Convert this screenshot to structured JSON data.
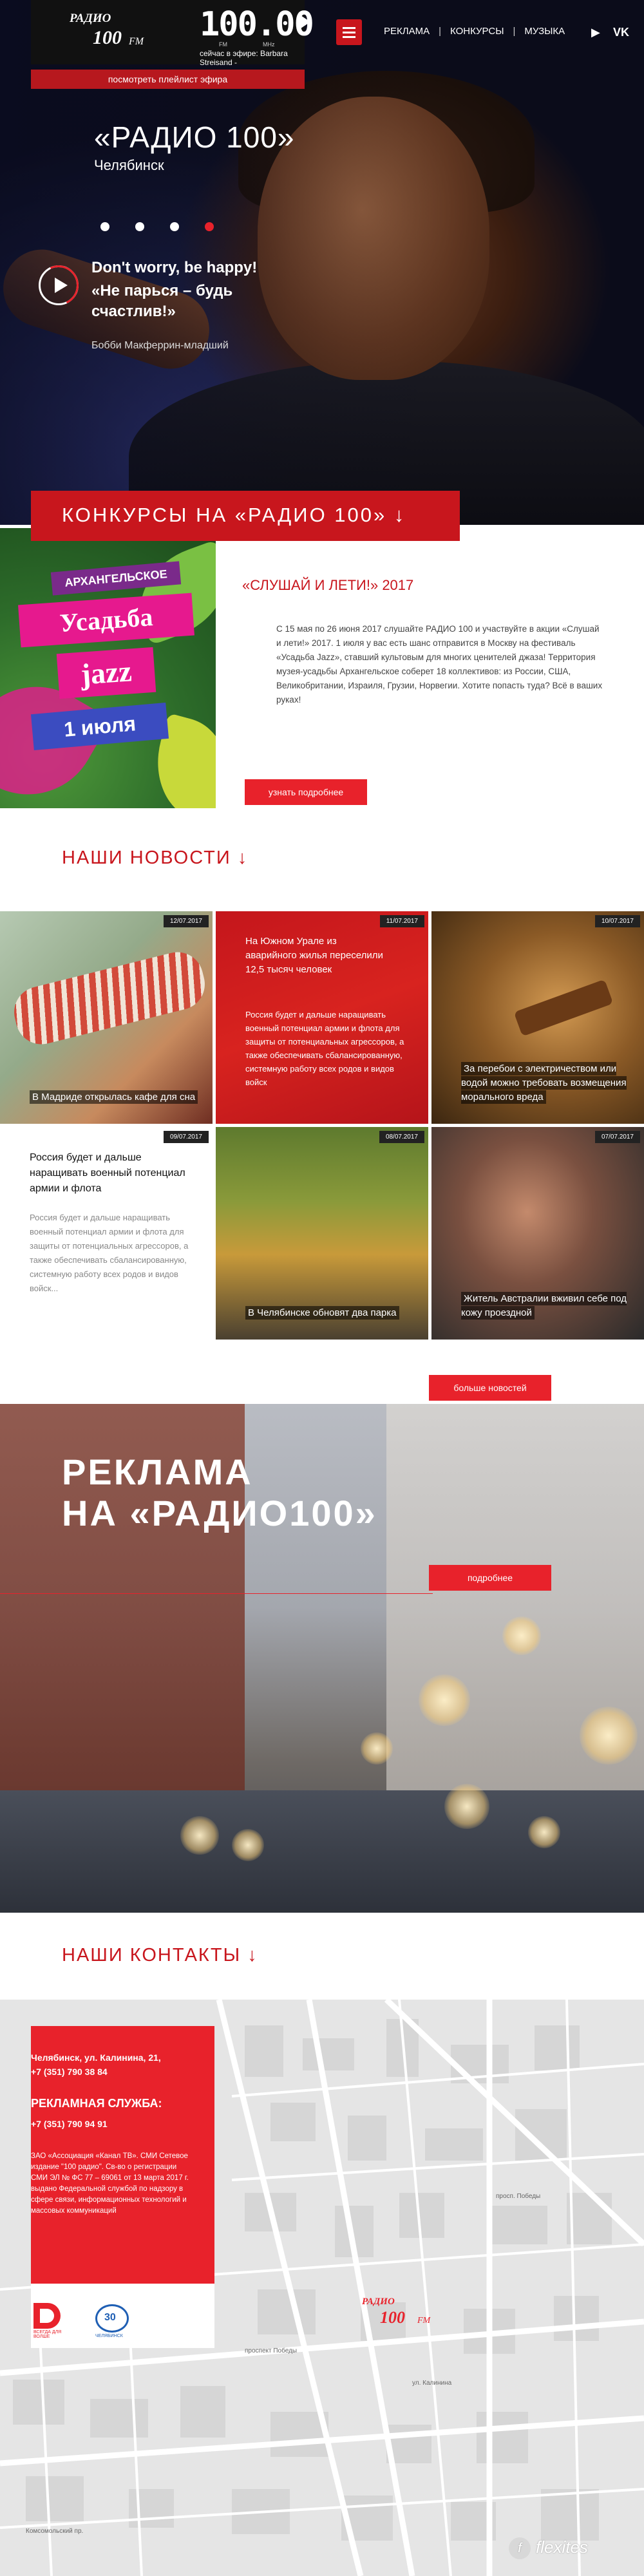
{
  "header": {
    "logo_line1": "РАДИО",
    "logo_line2": "100",
    "logo_line3": "FM",
    "frequency": "100.00",
    "freq_fm": "FM",
    "freq_mhz": "MHz",
    "now_on_air": "сейчас в эфире: Barbara Streisand -",
    "playlist_button": "посмотреть плейлист эфира",
    "nav": [
      "РЕКЛАМА",
      "КОНКУРСЫ",
      "МУЗЫКА"
    ],
    "social_youtube": "▶",
    "social_vk": "VK",
    "brand_red": "#e8222b"
  },
  "hero": {
    "title": "«РАДИО 100»",
    "city": "Челябинск",
    "song_en": "Don't worry, be happy!",
    "song_ru": "«Не парься – будь счастлив!»",
    "artist": "Бобби Макферрин-младший",
    "slides": 4,
    "active_slide": 4
  },
  "contests": {
    "section_title": "КОНКУРСЫ НА «РАДИО 100»",
    "arrow": "↓",
    "card_ribbon1": "АРХАНГЕЛЬСКОЕ",
    "card_ribbon2": "Усадьба",
    "card_ribbon3": "jazz",
    "card_ribbon4": "1 июля",
    "heading": "«СЛУШАЙ И ЛЕТИ!» 2017",
    "text": "С 15 мая по 26 июня 2017 слушайте РАДИО 100 и участвуйте в акции «Слушай и лети!» 2017. 1 июля у вас есть шанс отправится в Москву на фестиваль «Усадьба Jazz», ставший культовым для многих ценителей джаза! Территория музея-усадьбы Архангельское соберет 18 коллективов: из России, США, Великобритании, Израиля, Грузии, Норвегии. Хотите попасть туда? Всё в ваших руках!",
    "button": "узнать подробнее"
  },
  "news": {
    "section_title": "НАШИ НОВОСТИ",
    "arrow": "↓",
    "items": [
      {
        "date": "12/07.2017",
        "title": "В Мадриде открылась кафе для сна"
      },
      {
        "date": "11/07.2017",
        "title": "На Южном Урале из аварийного жилья переселили 12,5 тысяч человек",
        "excerpt": "Россия будет и дальше наращивать военный потенциал армии и флота для защиты от потенциальных агрессоров, а также обеспечивать сбалансированную, системную работу всех родов и видов войск"
      },
      {
        "date": "10/07.2017",
        "title": "За перебои с электричеством или водой можно требовать возмещения морального вреда"
      },
      {
        "date": "09/07.2017",
        "title": "Россия будет и дальше наращивать военный потенциал армии и флота",
        "excerpt": "Россия будет и дальше наращивать военный потенциал армии и флота для защиты от потенциальных агрессоров, а также обеспечивать сбалансированную, системную работу всех родов и видов войск..."
      },
      {
        "date": "08/07.2017",
        "title": "В Челябинске обновят два парка"
      },
      {
        "date": "07/07.2017",
        "title": "Житель Австралии вживил себе под кожу проездной"
      }
    ],
    "more_button": "больше новостей"
  },
  "ads": {
    "title_line1": "РЕКЛАМА",
    "title_line2": "НА «РАДИО100»",
    "button": "подробнее"
  },
  "contacts": {
    "section_title": "НАШИ КОНТАКТЫ",
    "arrow": "↓",
    "address": "Челябинск, ул. Калинина, 21,",
    "phone1": "+7 (351) 790 38 84",
    "ads_service_label": "РЕКЛАМНАЯ СЛУЖБА:",
    "phone2": "+7 (351) 790 94 91",
    "legal": "ЗАО «Ассоциация «Канал ТВ». СМИ Сетевое издание \"100 радио\". Св-во о регистрации СМИ ЭЛ № ФС 77 – 69061 от 13 марта 2017 г. выдано Федеральной службой по надзору в сфере связи, информационных технологий и массовых коммуникаций",
    "logo_d_text": "ВСЕГДА ДЛЯ ВОЛШЕ",
    "logo_v_number": "30",
    "logo_v_text": "ЧЕЛЯБИНСК",
    "streets": [
      "просп. Победы",
      "проспект Победы",
      "ул. Калинина",
      "Комсомольский пр."
    ],
    "pin_line1": "РАДИО",
    "pin_line2": "100",
    "pin_line3": "FM"
  },
  "footer": {
    "badge": "f",
    "brand": "flexites"
  }
}
